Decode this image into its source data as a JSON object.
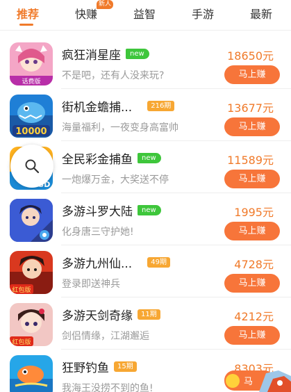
{
  "tabs": [
    {
      "label": "推荐",
      "active": true
    },
    {
      "label": "快赚",
      "active": false,
      "badge": "新人"
    },
    {
      "label": "益智",
      "active": false
    },
    {
      "label": "手游",
      "active": false
    },
    {
      "label": "最新",
      "active": false
    }
  ],
  "accent_color": "#f07a2a",
  "earn_label": "马上赚",
  "games": [
    {
      "title": "疯狂消星座",
      "tag": "new",
      "tag_type": "new",
      "desc": "不是吧，还有人没来玩?",
      "reward": "18650元",
      "icon_label": "话费版"
    },
    {
      "title": "街机金蟾捕...",
      "tag": "216期",
      "tag_type": "period",
      "desc": "海量福利，一夜变身高富帅",
      "reward": "13677元",
      "icon_label": "10000"
    },
    {
      "title": "全民彩金捕鱼",
      "tag": "new",
      "tag_type": "new",
      "desc": "一炮爆万金，大奖送不停",
      "reward": "11589元",
      "icon_label": "3D"
    },
    {
      "title": "多游斗罗大陆",
      "tag": "new",
      "tag_type": "new",
      "desc": "化身唐三守护她!",
      "reward": "1995元",
      "icon_label": ""
    },
    {
      "title": "多游九州仙...",
      "tag": "49期",
      "tag_type": "period",
      "desc": "登录即送神兵",
      "reward": "4728元",
      "icon_label": "红包版"
    },
    {
      "title": "多游天剑奇缘",
      "tag": "11期",
      "tag_type": "period",
      "desc": "剑侣情缘，江湖邂逅",
      "reward": "4212元",
      "icon_label": "红包版"
    },
    {
      "title": "狂野钓鱼",
      "tag": "15期",
      "tag_type": "period",
      "desc": "我海王没捞不到的鱼!",
      "reward": "8303元",
      "icon_label": "马"
    }
  ]
}
